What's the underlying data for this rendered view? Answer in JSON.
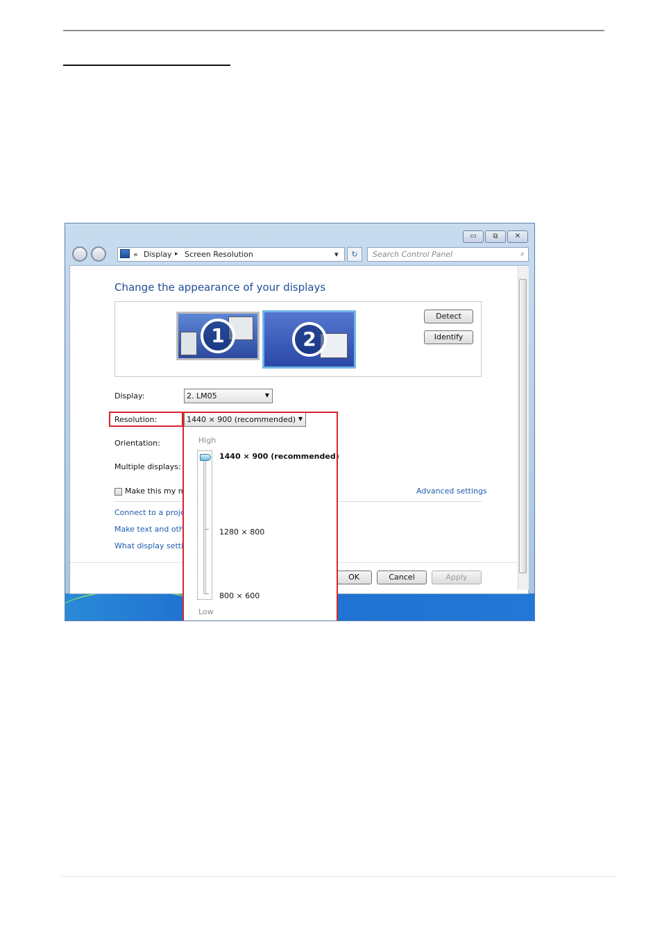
{
  "window": {
    "controls": {
      "minimize": "▭",
      "maximize": "⧉",
      "close": "✕"
    },
    "address": {
      "back_icon": "back-arrow-icon",
      "crumb_prefix": "«",
      "crumb1": "Display",
      "sep": "▸",
      "crumb2": "Screen Resolution",
      "dropdown": "▾"
    },
    "refresh": "↻",
    "search_placeholder": "Search Control Panel",
    "search_icon": "⌕"
  },
  "main": {
    "title": "Change the appearance of your displays",
    "monitors": [
      "1",
      "2"
    ],
    "detect_label": "Detect",
    "identify_label": "Identify",
    "display_label": "Display:",
    "display_value": "2. LM05",
    "resolution_label": "Resolution:",
    "resolution_value": "1440 × 900 (recommended)",
    "orientation_label": "Orientation:",
    "multiple_label": "Multiple displays:",
    "make_main_label": "Make this my m",
    "advanced_link": "Advanced settings",
    "links": [
      "Connect to a projec",
      "Make text and othe",
      "What display settin"
    ],
    "ok_label": "OK",
    "cancel_label": "Cancel",
    "apply_label": "Apply"
  },
  "resolution_popup": {
    "high_label": "High",
    "low_label": "Low",
    "options": [
      "1440 × 900 (recommended)",
      "1280 × 800",
      "800 × 600"
    ],
    "selected": "1440 × 900 (recommended)"
  },
  "colors": {
    "highlight": "#d8232a",
    "link": "#1e5bb0",
    "title": "#1e4d99"
  }
}
